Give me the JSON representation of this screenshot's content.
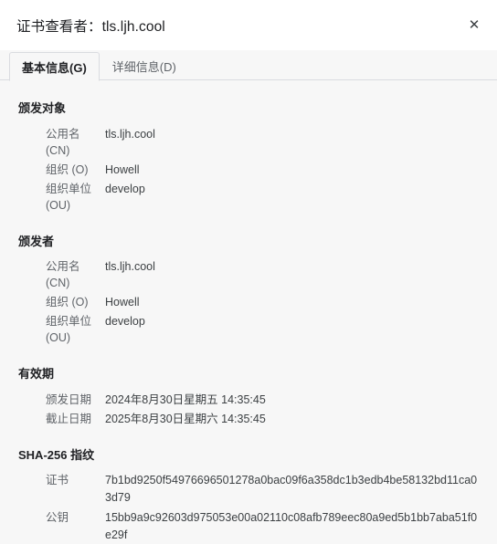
{
  "window": {
    "title": "证书查看者：tls.ljh.cool",
    "close_icon": "close-icon",
    "close_glyph": "✕"
  },
  "tabs": [
    {
      "label": "基本信息(G)",
      "active": true
    },
    {
      "label": "详细信息(D)",
      "active": false
    }
  ],
  "sections": [
    {
      "title": "颁发对象",
      "rows": [
        {
          "label": "公用名 (CN)",
          "value": "tls.ljh.cool"
        },
        {
          "label": "组织 (O)",
          "value": "Howell"
        },
        {
          "label": "组织单位 (OU)",
          "value": "develop"
        }
      ]
    },
    {
      "title": "颁发者",
      "rows": [
        {
          "label": "公用名 (CN)",
          "value": "tls.ljh.cool"
        },
        {
          "label": "组织 (O)",
          "value": "Howell"
        },
        {
          "label": "组织单位 (OU)",
          "value": "develop"
        }
      ]
    },
    {
      "title": "有效期",
      "rows": [
        {
          "label": "颁发日期",
          "value": "2024年8月30日星期五 14:35:45"
        },
        {
          "label": "截止日期",
          "value": "2025年8月30日星期六 14:35:45"
        }
      ]
    },
    {
      "title": "SHA-256 指纹",
      "rows": [
        {
          "label": "证书",
          "value": "7b1bd9250f54976696501278a0bac09f6a358dc1b3edb4be58132bd11ca03d79"
        },
        {
          "label": "公钥",
          "value": "15bb9a9c92603d975053e00a02110c08afb789eec80a9ed5b1bb7aba51f0e29f"
        }
      ]
    }
  ],
  "colors": {
    "titlebar_bg": "#ffffff",
    "body_bg": "#f7f7f7",
    "border": "#dadce0",
    "label_text": "#5f6368",
    "value_text": "#3c4043",
    "heading_text": "#202124"
  }
}
